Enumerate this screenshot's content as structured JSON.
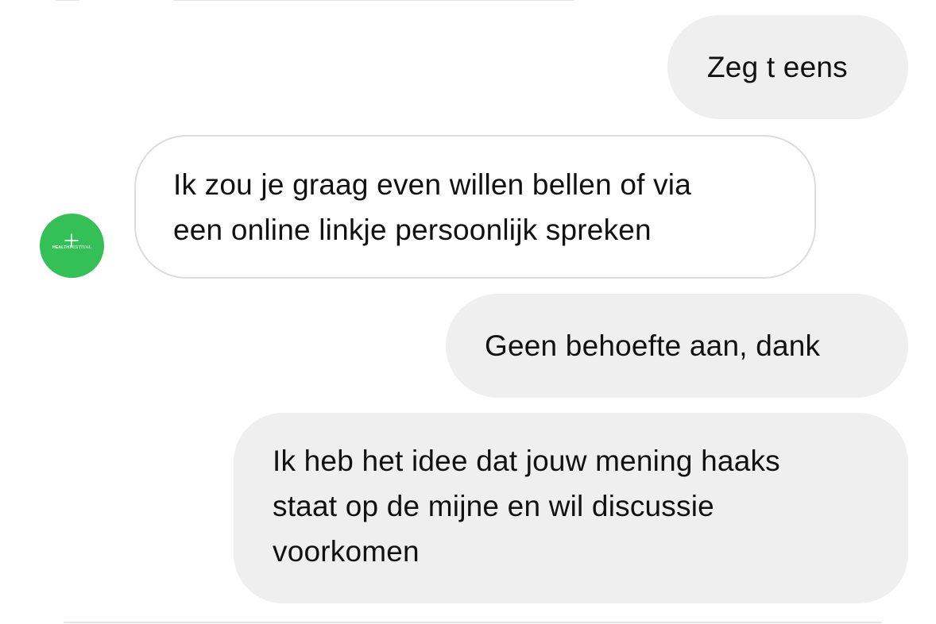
{
  "conversation": {
    "messages": [
      {
        "direction": "outgoing",
        "text": "Zeg t eens"
      },
      {
        "direction": "incoming",
        "text": "Ik zou je graag even willen bellen of via\neen online linkje persoonlijk spreken"
      },
      {
        "direction": "outgoing",
        "text": "Geen behoefte aan, dank"
      },
      {
        "direction": "outgoing",
        "text": "Ik heb het idee dat jouw mening haaks\nstaat op de mijne en wil discussie\nvoorkomen"
      }
    ]
  },
  "contact": {
    "avatar": {
      "logo_bold": "HEALTH",
      "logo_rest": "FESTIVAL",
      "background_color": "#34bf57",
      "icon": "health-festival-logo-icon"
    }
  },
  "colors": {
    "outgoing_bubble": "#efefef",
    "incoming_bubble": "#ffffff",
    "incoming_border": "#dcdcdc",
    "text": "#111111"
  }
}
